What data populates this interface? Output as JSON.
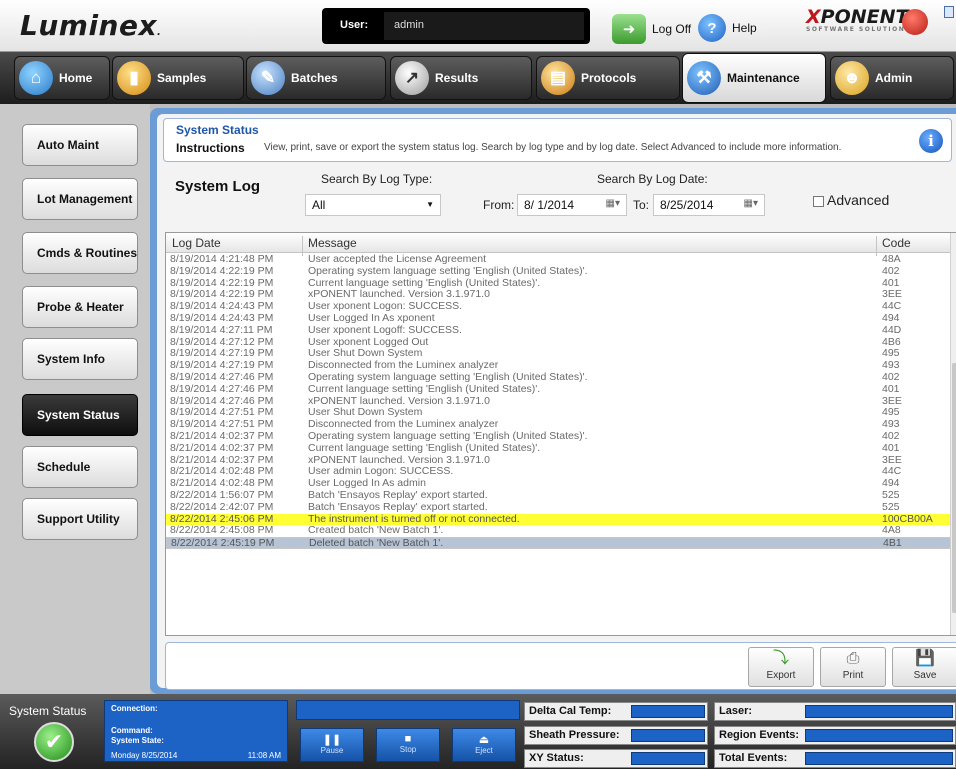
{
  "header": {
    "logo": "Luminex",
    "user_label": "User:",
    "user_value": "admin",
    "logoff_label": "Log Off",
    "help_label": "Help",
    "brand": "XPONENT",
    "brand_sub": "SOFTWARE SOLUTIONS"
  },
  "nav": {
    "tabs": [
      {
        "label": "Home",
        "icon": "home-icon"
      },
      {
        "label": "Samples",
        "icon": "samples-icon"
      },
      {
        "label": "Batches",
        "icon": "batches-icon"
      },
      {
        "label": "Results",
        "icon": "results-icon"
      },
      {
        "label": "Protocols",
        "icon": "protocols-icon"
      },
      {
        "label": "Maintenance",
        "icon": "maintenance-icon"
      },
      {
        "label": "Admin",
        "icon": "admin-icon"
      }
    ],
    "active": "Maintenance"
  },
  "sidebar": {
    "items": [
      {
        "label": "Auto Maint"
      },
      {
        "label": "Lot Management"
      },
      {
        "label": "Cmds & Routines"
      },
      {
        "label": "Probe & Heater"
      },
      {
        "label": "System Info"
      },
      {
        "label": "System Status"
      },
      {
        "label": "Schedule"
      },
      {
        "label": "Support Utility"
      }
    ],
    "active": "System Status"
  },
  "instructions": {
    "title": "System Status",
    "label": "Instructions",
    "text": "View, print, save or export the system status log. Search by log type and by log date. Select Advanced to include more information."
  },
  "filters": {
    "section_title": "System Log",
    "log_type_label": "Search By Log Type:",
    "log_type_value": "All",
    "log_date_label": "Search By Log Date:",
    "from_label": "From:",
    "from_value": "8/ 1/2014",
    "to_label": "To:",
    "to_value": "8/25/2014",
    "advanced_label": "Advanced",
    "advanced_checked": false
  },
  "table": {
    "columns": [
      "Log Date",
      "Message",
      "Code"
    ],
    "rows": [
      {
        "date": "8/19/2014 4:21:48 PM",
        "message": "User accepted the License Agreement",
        "code": "48A"
      },
      {
        "date": "8/19/2014 4:22:19 PM",
        "message": "Operating system language setting 'English (United States)'.",
        "code": "402"
      },
      {
        "date": "8/19/2014 4:22:19 PM",
        "message": "Current language setting 'English (United States)'.",
        "code": "401"
      },
      {
        "date": "8/19/2014 4:22:19 PM",
        "message": "xPONENT launched. Version 3.1.971.0",
        "code": "3EE"
      },
      {
        "date": "8/19/2014 4:24:43 PM",
        "message": "User xponent Logon: SUCCESS.",
        "code": "44C"
      },
      {
        "date": "8/19/2014 4:24:43 PM",
        "message": "User Logged In As xponent",
        "code": "494"
      },
      {
        "date": "8/19/2014 4:27:11 PM",
        "message": "User xponent Logoff: SUCCESS.",
        "code": "44D"
      },
      {
        "date": "8/19/2014 4:27:12 PM",
        "message": "User xponent Logged Out",
        "code": "4B6"
      },
      {
        "date": "8/19/2014 4:27:19 PM",
        "message": "User Shut Down System",
        "code": "495"
      },
      {
        "date": "8/19/2014 4:27:19 PM",
        "message": "Disconnected from the Luminex analyzer",
        "code": "493"
      },
      {
        "date": "8/19/2014 4:27:46 PM",
        "message": "Operating system language setting 'English (United States)'.",
        "code": "402"
      },
      {
        "date": "8/19/2014 4:27:46 PM",
        "message": "Current language setting 'English (United States)'.",
        "code": "401"
      },
      {
        "date": "8/19/2014 4:27:46 PM",
        "message": "xPONENT launched. Version 3.1.971.0",
        "code": "3EE"
      },
      {
        "date": "8/19/2014 4:27:51 PM",
        "message": "User Shut Down System",
        "code": "495"
      },
      {
        "date": "8/19/2014 4:27:51 PM",
        "message": "Disconnected from the Luminex analyzer",
        "code": "493"
      },
      {
        "date": "8/21/2014 4:02:37 PM",
        "message": "Operating system language setting 'English (United States)'.",
        "code": "402"
      },
      {
        "date": "8/21/2014 4:02:37 PM",
        "message": "Current language setting 'English (United States)'.",
        "code": "401"
      },
      {
        "date": "8/21/2014 4:02:37 PM",
        "message": "xPONENT launched. Version 3.1.971.0",
        "code": "3EE"
      },
      {
        "date": "8/21/2014 4:02:48 PM",
        "message": "User admin Logon: SUCCESS.",
        "code": "44C"
      },
      {
        "date": "8/21/2014 4:02:48 PM",
        "message": "User Logged In As admin",
        "code": "494"
      },
      {
        "date": "8/22/2014 1:56:07 PM",
        "message": "Batch 'Ensayos Replay' export started.",
        "code": "525"
      },
      {
        "date": "8/22/2014 2:42:07 PM",
        "message": "Batch 'Ensayos Replay' export started.",
        "code": "525"
      },
      {
        "date": "8/22/2014 2:45:06 PM",
        "message": "The instrument is turned off or not connected.",
        "code": "100CB00A",
        "highlight": true
      },
      {
        "date": "8/22/2014 2:45:08 PM",
        "message": "Created batch 'New Batch 1'.",
        "code": "4A8"
      },
      {
        "date": "8/22/2014 2:45:19 PM",
        "message": "Deleted batch 'New Batch 1'.",
        "code": "4B1",
        "selected": true
      }
    ]
  },
  "actions": {
    "export": "Export",
    "print": "Print",
    "save": "Save"
  },
  "statusbar": {
    "title": "System Status",
    "connection_label": "Connection:",
    "command_label": "Command:",
    "state_label": "System State:",
    "date": "Monday 8/25/2014",
    "time": "11:08 AM",
    "pause": "Pause",
    "stop": "Stop",
    "eject": "Eject",
    "delta_cal_temp": "Delta Cal Temp:",
    "sheath_pressure": "Sheath Pressure:",
    "xy_status": "XY Status:",
    "laser": "Laser:",
    "region_events": "Region Events:",
    "total_events": "Total Events:"
  },
  "colors": {
    "accent_blue": "#1d63c5",
    "panel_blue": "#6b9cd6",
    "highlight_yellow": "#ffff33",
    "selected_row": "#b7c4d6"
  }
}
